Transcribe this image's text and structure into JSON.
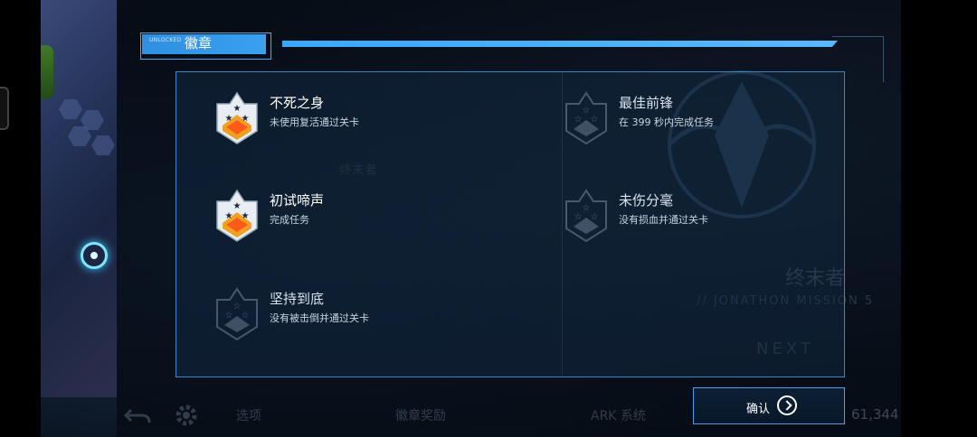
{
  "header": {
    "small_label": "UNLOCKED",
    "title": "徽章"
  },
  "badges": [
    {
      "title": "不死之身",
      "desc": "未使用复活通过关卡",
      "unlocked": true
    },
    {
      "title": "最佳前锋",
      "desc": "在 399 秒内完成任务",
      "unlocked": false
    },
    {
      "title": "初试啼声",
      "desc": "完成任务",
      "unlocked": true
    },
    {
      "title": "未伤分毫",
      "desc": "没有损血并通过关卡",
      "unlocked": false
    },
    {
      "title": "坚持到底",
      "desc": "没有被击倒并通过关卡",
      "unlocked": false
    }
  ],
  "confirm": {
    "label": "确认"
  },
  "background": {
    "character_name": "终末者",
    "mission_text": "// JONATHON MISSION 5",
    "next_label": "NEXT",
    "left_faded": "终末者",
    "bottom_options": "选项",
    "bottom_badge_reward": "徽章奖励",
    "bottom_ark": "ARK 系统",
    "currency": "61,344"
  },
  "colors": {
    "accent": "#3aa6ff",
    "panel_border": "#3b86c4"
  },
  "icons": {
    "unlocked_badge": "gold-star-shield-icon",
    "locked_badge": "outline-star-shield-icon",
    "confirm": "circle-arrow-right-icon"
  }
}
